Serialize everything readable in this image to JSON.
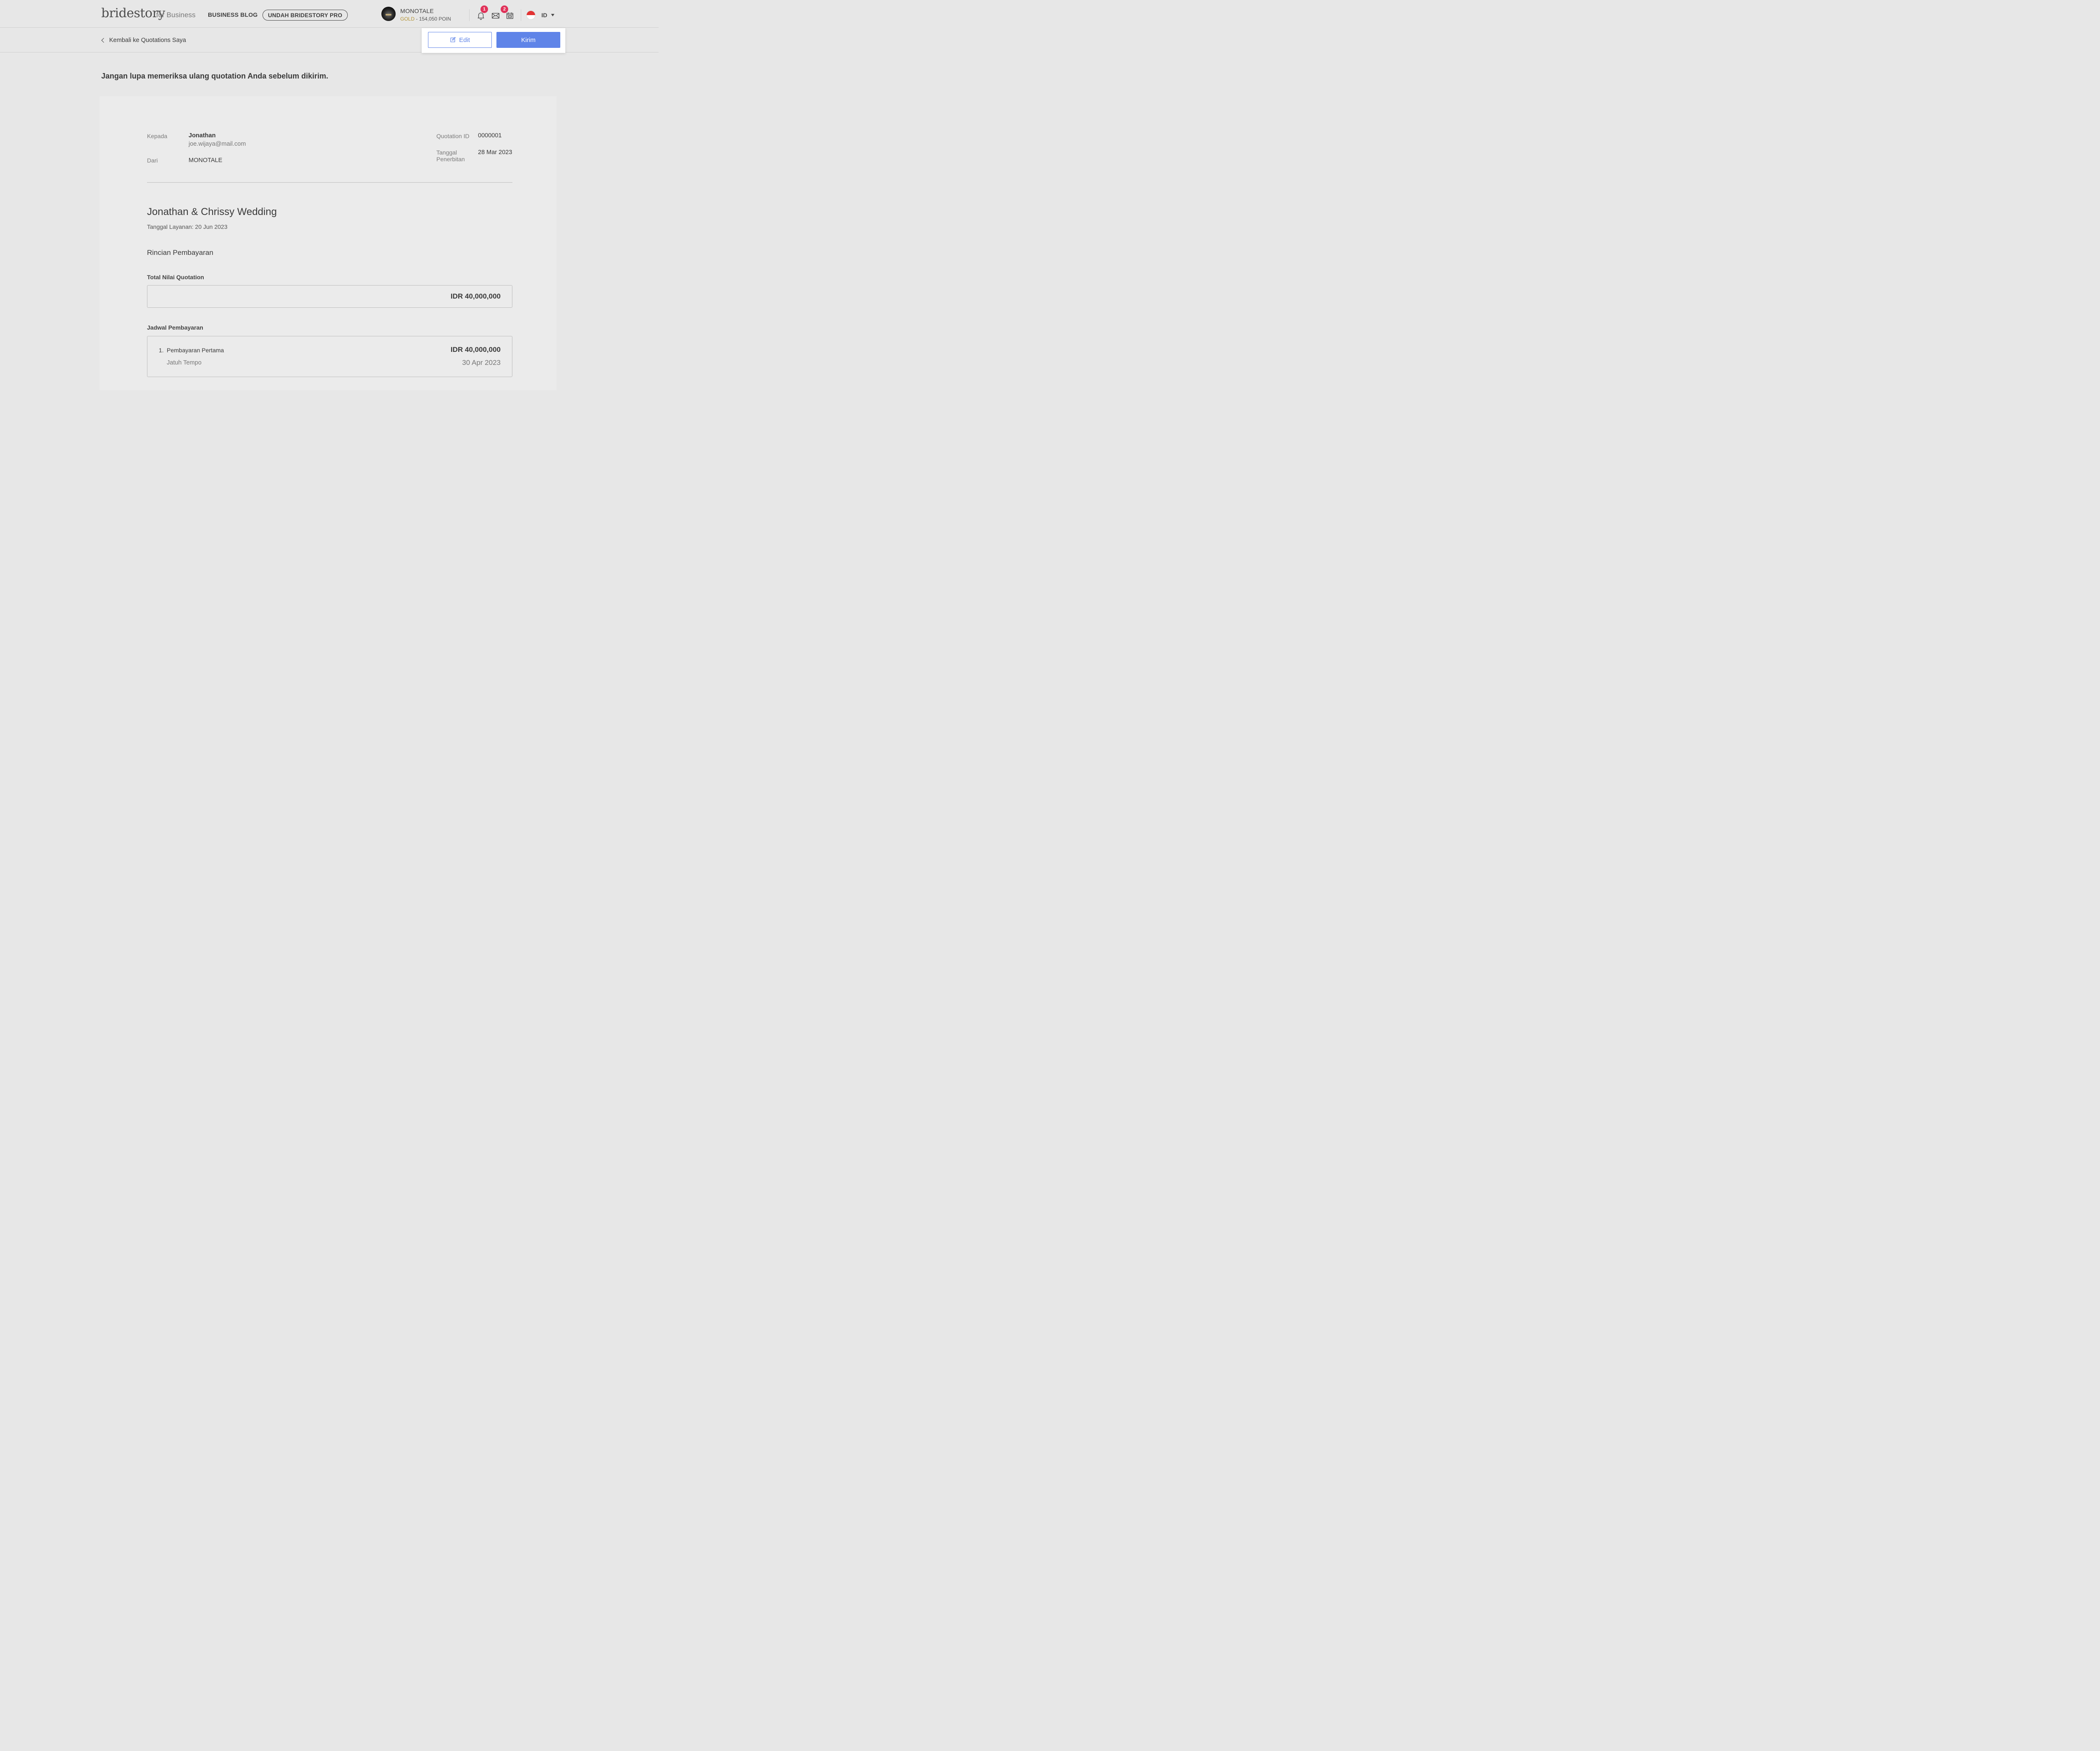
{
  "header": {
    "logo": "bridestory",
    "logo_suffix": "for Business",
    "nav_blog": "BUSINESS BLOG",
    "nav_pro": "UNDAH BRIDESTORY PRO",
    "user": {
      "name": "MONOTALE",
      "tier": "GOLD",
      "points": "- 154,050 POIN"
    },
    "icons": {
      "notifications": {
        "icon": "bell-icon",
        "badge": "1"
      },
      "messages": {
        "icon": "mail-icon",
        "badge": "2"
      },
      "calendar": {
        "icon": "calendar-icon"
      }
    },
    "language": "ID"
  },
  "subbar": {
    "back_label": "Kembali ke Quotations Saya",
    "edit_label": "Edit",
    "send_label": "Kirim"
  },
  "reminder": "Jangan lupa memeriksa ulang quotation Anda sebelum dikirim.",
  "quotation": {
    "to_label": "Kepada",
    "to_name": "Jonathan",
    "to_email": "joe.wijaya@mail.com",
    "from_label": "Dari",
    "from_name": "MONOTALE",
    "id_label": "Quotation ID",
    "id_value": "0000001",
    "issue_label": "Tanggal Penerbitan",
    "issue_date": "28 Mar 2023",
    "event_title": "Jonathan & Chrissy Wedding",
    "service_date": "Tanggal Layanan: 20 Jun 2023",
    "payment_section": "Rincian Pembayaran",
    "total_label": "Total Nilai Quotation",
    "total_value": "IDR 40,000,000",
    "schedule_label": "Jadwal Pembayaran",
    "schedule": [
      {
        "number": "1.",
        "name": "Pembayaran Pertama",
        "due_label": "Jatuh Tempo",
        "amount": "IDR 40,000,000",
        "due_date": "30 Apr 2023"
      }
    ]
  },
  "colors": {
    "primary": "#5f84e8",
    "badge": "#e0335a",
    "gold": "#b39334",
    "background": "#e7e7e7"
  }
}
